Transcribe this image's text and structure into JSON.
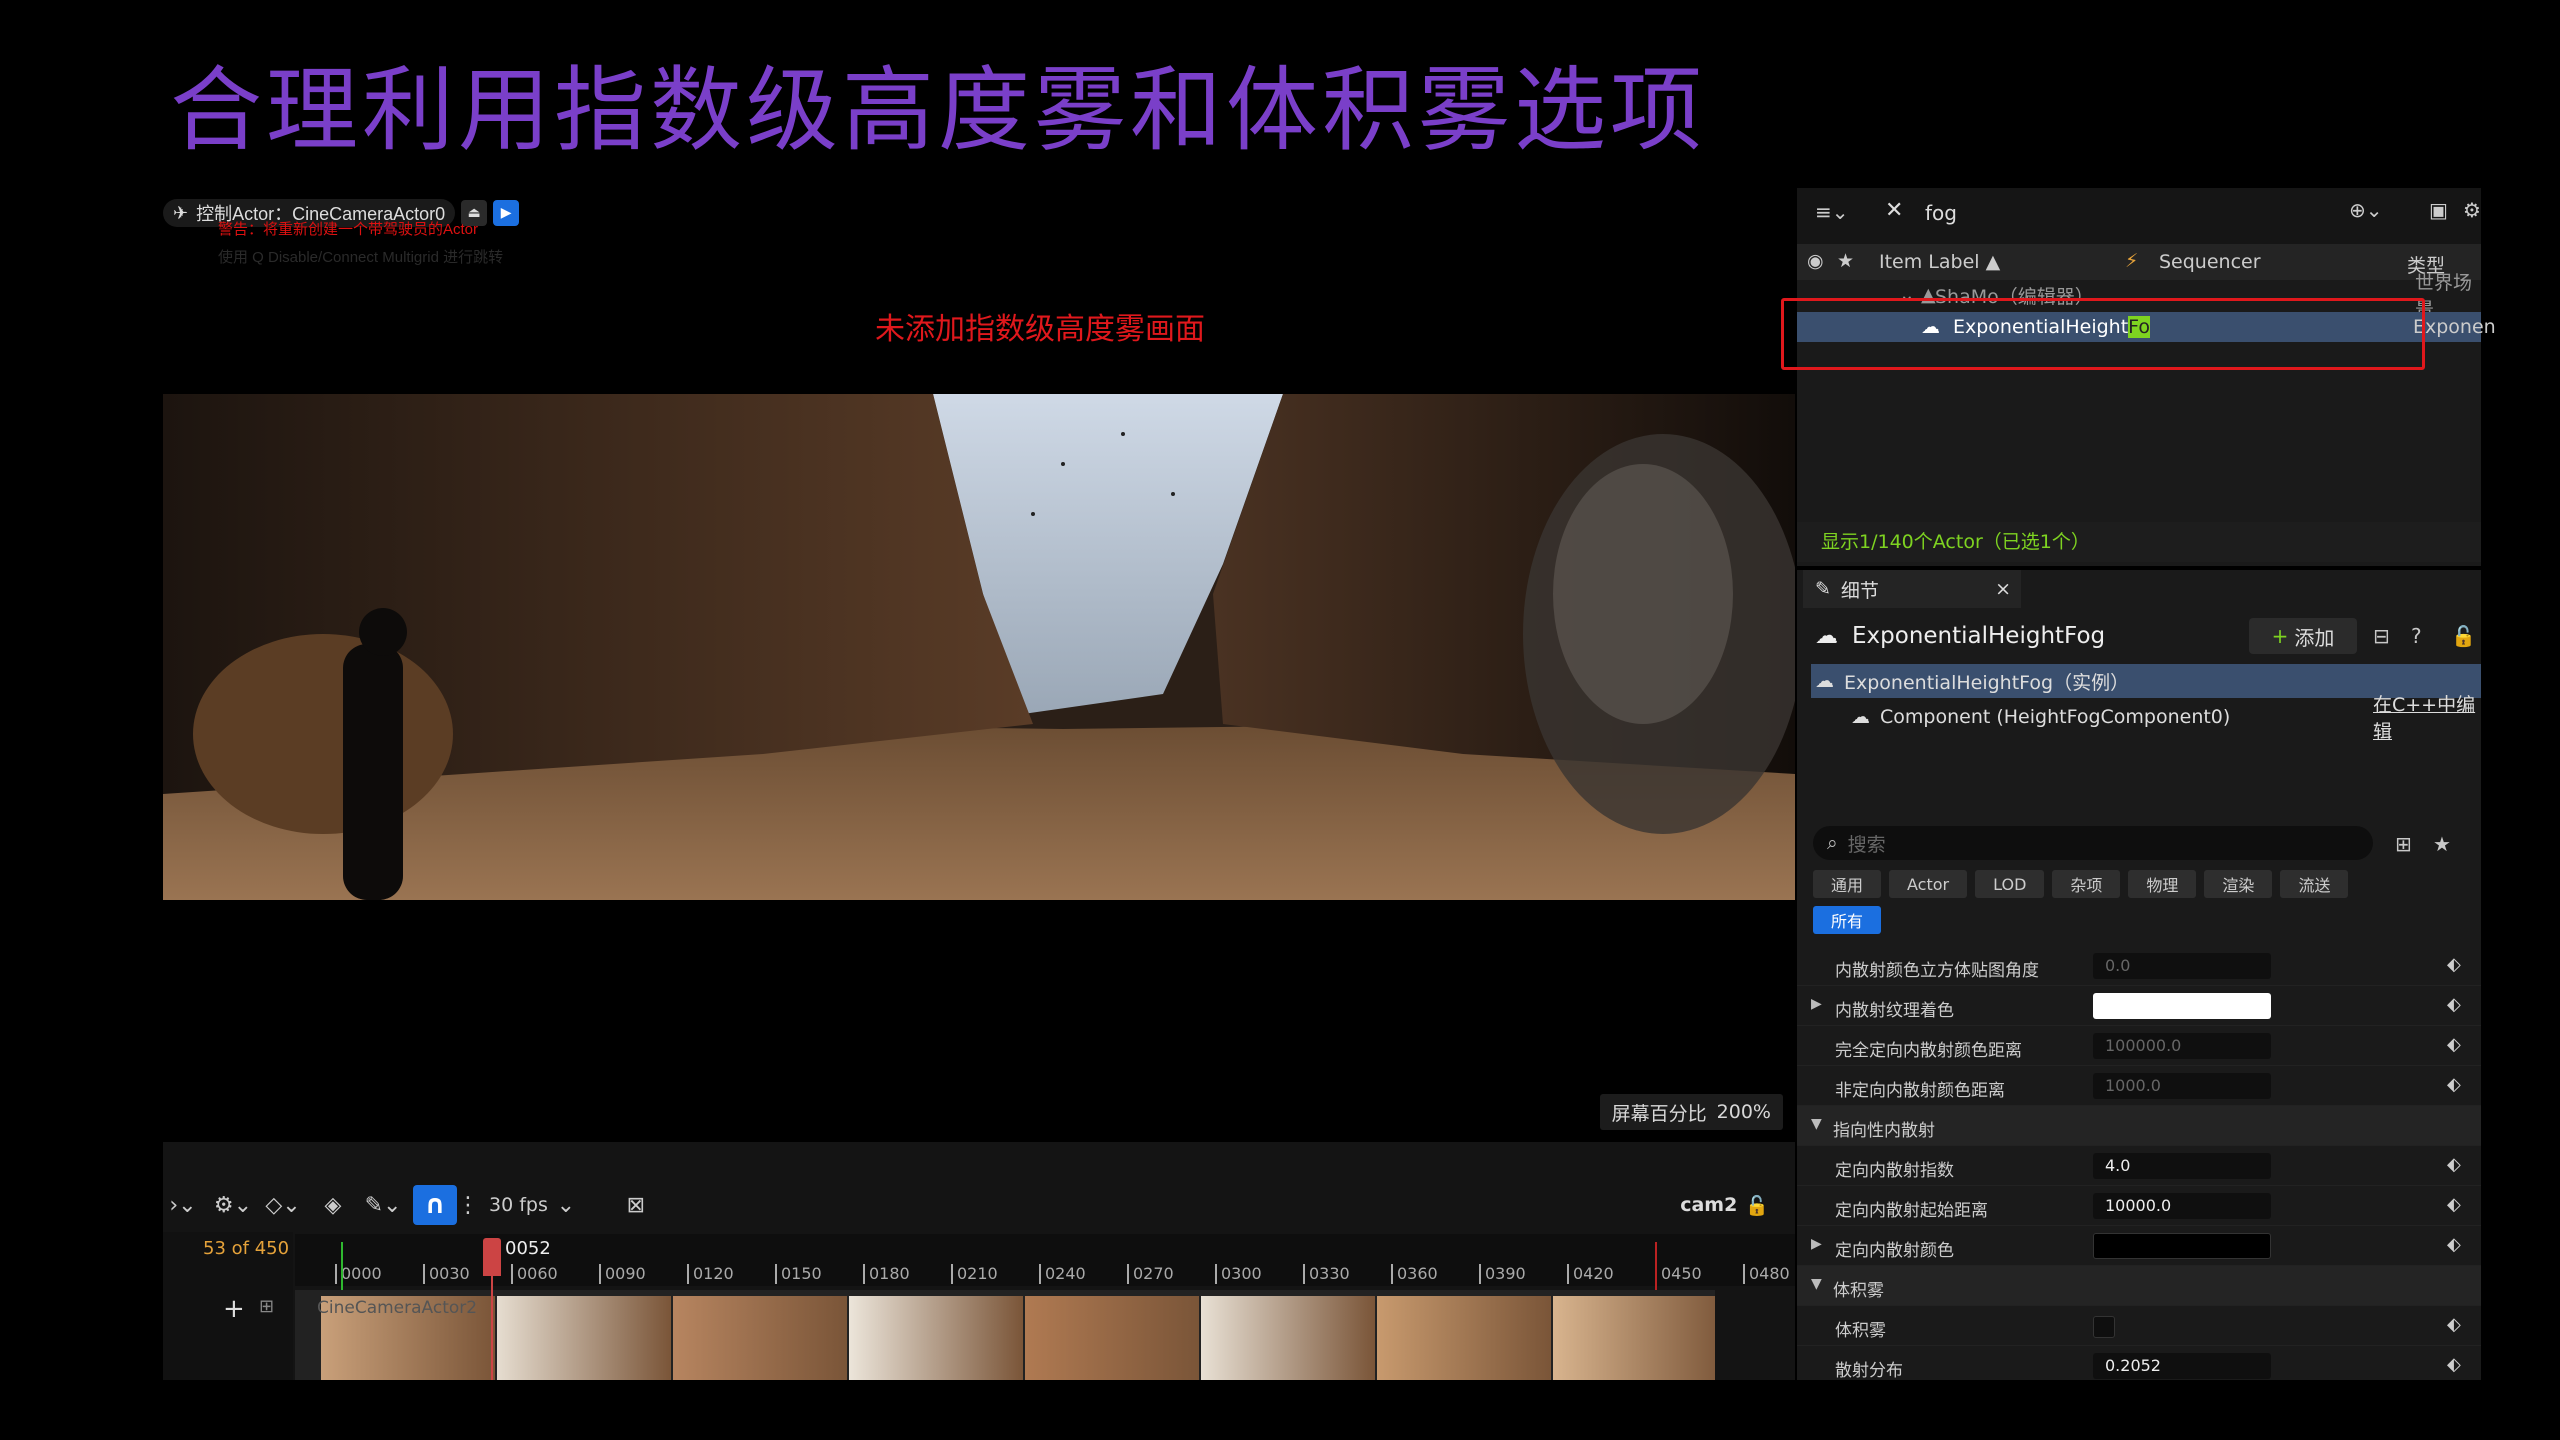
{
  "slide": {
    "title": "合理利用指数级高度雾和体积雾选项"
  },
  "viewport": {
    "pilot_label": "控制Actor：CineCameraActor0",
    "pilot_warning": "警告：将重新创建一个带驾驶员的Actor",
    "pilot_hint": "使用 Q Disable/Connect Multigrid 进行跳转",
    "caption": "未添加指数级高度雾画面",
    "screen_percentage_label": "屏幕百分比",
    "screen_percentage_value": "200%"
  },
  "sequencer": {
    "fps": "30 fps",
    "camera": "cam2",
    "frame_count": "53 of 450",
    "playhead": "0052",
    "track_label": "CineCameraActor2",
    "ticks": [
      "0000",
      "0030",
      "0060",
      "0090",
      "0120",
      "0150",
      "0180",
      "0210",
      "0240",
      "0270",
      "0300",
      "0330",
      "0360",
      "0390",
      "0420",
      "0450",
      "0480"
    ]
  },
  "outliner": {
    "search_value": "fog",
    "col_label": "Item Label ▲",
    "col_sequencer": "Sequencer",
    "col_type": "类型",
    "row_world": "ShaMo（编辑器）",
    "row_world_type": "世界场景",
    "row_fog_prefix": "ExponentialHeight",
    "row_fog_highlight": "Fo",
    "row_fog_type": "Exponen",
    "status": "显示1/140个Actor（已选1个）"
  },
  "details": {
    "tab": "细节",
    "title": "ExponentialHeightFog",
    "add_label": "添加",
    "instance_row": "ExponentialHeightFog（实例）",
    "component_row": "Component (HeightFogComponent0)",
    "edit_cpp": "在C++中编辑",
    "search_placeholder": "搜索",
    "filters": [
      "通用",
      "Actor",
      "LOD",
      "杂项",
      "物理",
      "渲染",
      "流送"
    ],
    "filter_all": "所有",
    "props": [
      {
        "name": "内散射颜色立方体贴图角度",
        "value": "0.0"
      },
      {
        "name": "内散射纹理着色",
        "value": ""
      },
      {
        "name": "完全定向内散射颜色距离",
        "value": "100000.0"
      },
      {
        "name": "非定向内散射颜色距离",
        "value": "1000.0"
      }
    ],
    "section_directional": "指向性内散射",
    "props2": [
      {
        "name": "定向内散射指数",
        "value": "4.0"
      },
      {
        "name": "定向内散射起始距离",
        "value": "10000.0"
      },
      {
        "name": "定向内散射颜色",
        "value": ""
      }
    ],
    "section_volumetric": "体积雾",
    "prop_volumetric": "体积雾",
    "prop_scatter": "散射分布",
    "prop_scatter_value": "0.2052"
  },
  "colors": {
    "accent": "#1b6fe0",
    "title": "#7a3fc9",
    "warning": "#e0181c",
    "highlight": "#7ed321"
  }
}
